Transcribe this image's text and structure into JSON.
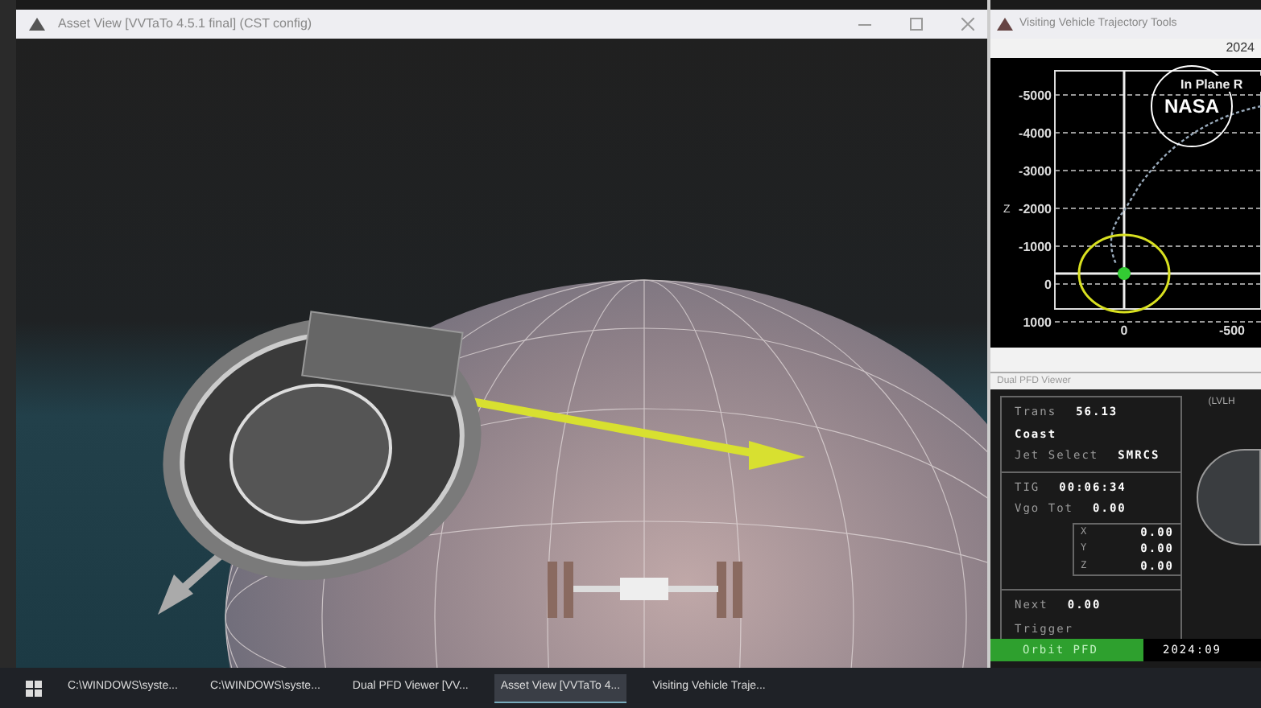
{
  "main_window": {
    "title": "Asset View [VVTaTo 4.5.1 final] (CST config)"
  },
  "trajectory_window": {
    "title": "Visiting Vehicle Trajectory Tools",
    "year": "2024",
    "plot": {
      "title": "In Plane R",
      "axis_label": "Z",
      "logo": "NASA",
      "y_ticks": [
        "-5000",
        "-4000",
        "-3000",
        "-2000",
        "-1000",
        "0",
        "1000"
      ],
      "x_ticks": [
        "0",
        "-500"
      ]
    }
  },
  "pfd_window": {
    "title": "Dual PFD Viewer",
    "frame_label": "(LVLH",
    "rows": [
      {
        "label": "Trans",
        "value": "56.13"
      },
      {
        "label": "Coast",
        "value": ""
      },
      {
        "label": "Jet Select",
        "value": "SMRCS"
      }
    ],
    "tig": {
      "label": "TIG",
      "value": "00:06:34"
    },
    "vgo": {
      "label": "Vgo Tot",
      "value": "0.00"
    },
    "components": [
      {
        "label": "X",
        "value": "0.00"
      },
      {
        "label": "Y",
        "value": "0.00"
      },
      {
        "label": "Z",
        "value": "0.00"
      }
    ],
    "next": {
      "label": "Next",
      "value": "0.00"
    },
    "trigger": "Trigger",
    "status": {
      "mode": "Orbit PFD",
      "time": "2024:09"
    }
  },
  "taskbar": [
    {
      "label": "C:\\WINDOWS\\syste...",
      "active": false
    },
    {
      "label": "C:\\WINDOWS\\syste...",
      "active": false
    },
    {
      "label": "Dual PFD Viewer [VV...",
      "active": false
    },
    {
      "label": "Asset View [VVTaTo 4...",
      "active": true
    },
    {
      "label": "Visiting Vehicle Traje...",
      "active": false
    }
  ]
}
